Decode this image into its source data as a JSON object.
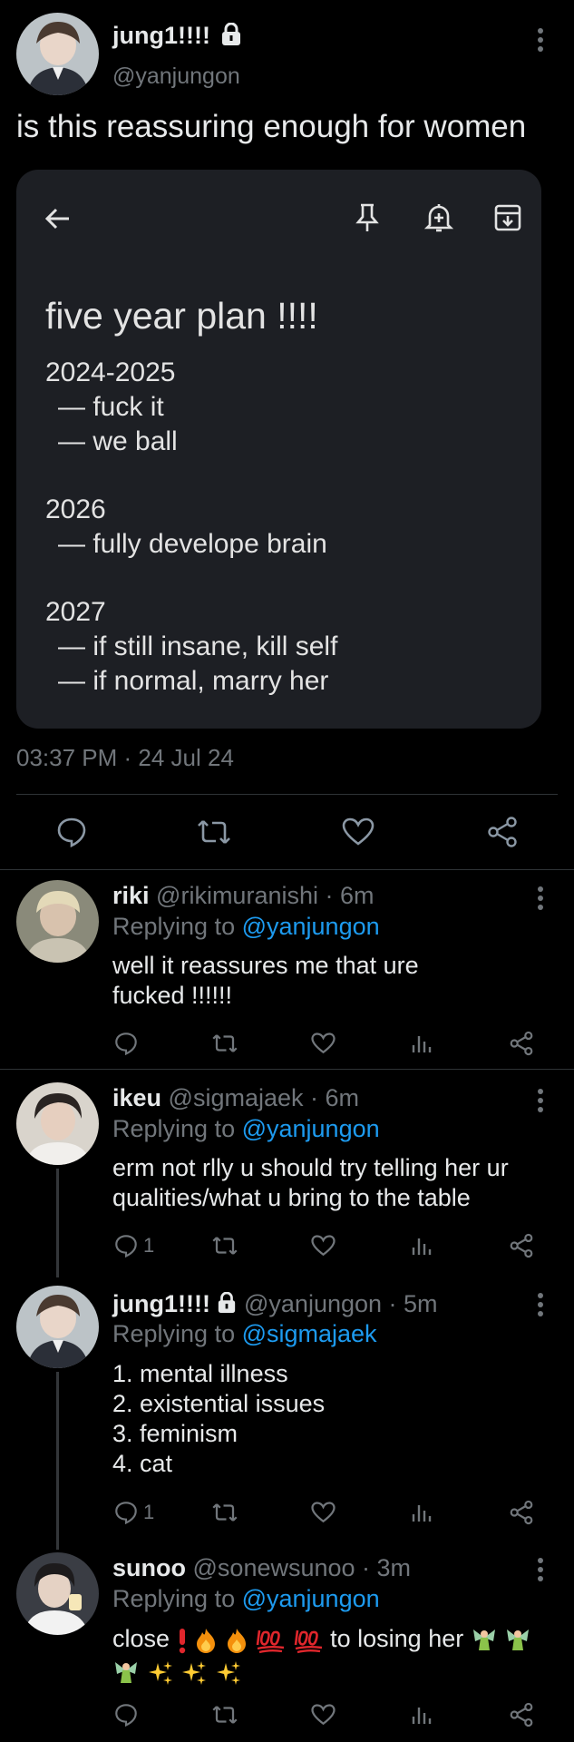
{
  "main_tweet": {
    "name": "jung1!!!!",
    "handle": "@yanjungon",
    "text": "is this reassuring enough for women",
    "timestamp": "03:37 PM · 24 Jul 24",
    "note": {
      "title": "five year plan !!!!",
      "lines": [
        "2024-2025",
        "— fuck it",
        "— we ball",
        "2026",
        "— fully develope brain",
        "2027",
        "— if still insane, kill self",
        "— if normal, marry her"
      ]
    }
  },
  "replies": [
    {
      "name": "riki",
      "handle_time": "@rikimuranishi · 6m",
      "replying_prefix": "Replying to ",
      "replying_to": "@yanjungon",
      "lines": [
        "well it reassures me that ure",
        "fucked !!!!!!"
      ],
      "reply_count": ""
    },
    {
      "name": "ikeu",
      "handle_time": "@sigmajaek · 6m",
      "replying_prefix": "Replying to ",
      "replying_to": "@yanjungon",
      "lines": [
        "erm not rlly u should try telling her ur",
        "qualities/what u bring to the table"
      ],
      "reply_count": "1"
    },
    {
      "name": "jung1!!!!",
      "handle_time": "@yanjungon · 5m",
      "replying_prefix": "Replying to ",
      "replying_to": "@sigmajaek",
      "lines": [
        "1. mental illness",
        "2. existential issues",
        "3. feminism",
        "4. cat"
      ],
      "reply_count": "1"
    },
    {
      "name": "sunoo",
      "handle_time": "@sonewsunoo · 3m",
      "replying_prefix": "Replying to ",
      "replying_to": "@yanjungon",
      "line1": "close",
      "line1b": "to losing her",
      "reply_count": ""
    }
  ],
  "colors": {
    "background": "#000000",
    "text": "#e7e9ea",
    "secondary": "#71767b",
    "link": "#1d9bf0",
    "note_card": "#1d1f24",
    "divider": "#2f3336"
  },
  "icons": {
    "lock": "lock-icon",
    "more": "more-vertical-icon",
    "back": "arrow-back-icon",
    "pin": "pin-icon",
    "reminder": "add-reminder-icon",
    "archive": "archive-icon",
    "reply": "reply-icon",
    "retweet": "retweet-icon",
    "like": "heart-icon",
    "views": "views-icon",
    "share": "share-icon"
  }
}
